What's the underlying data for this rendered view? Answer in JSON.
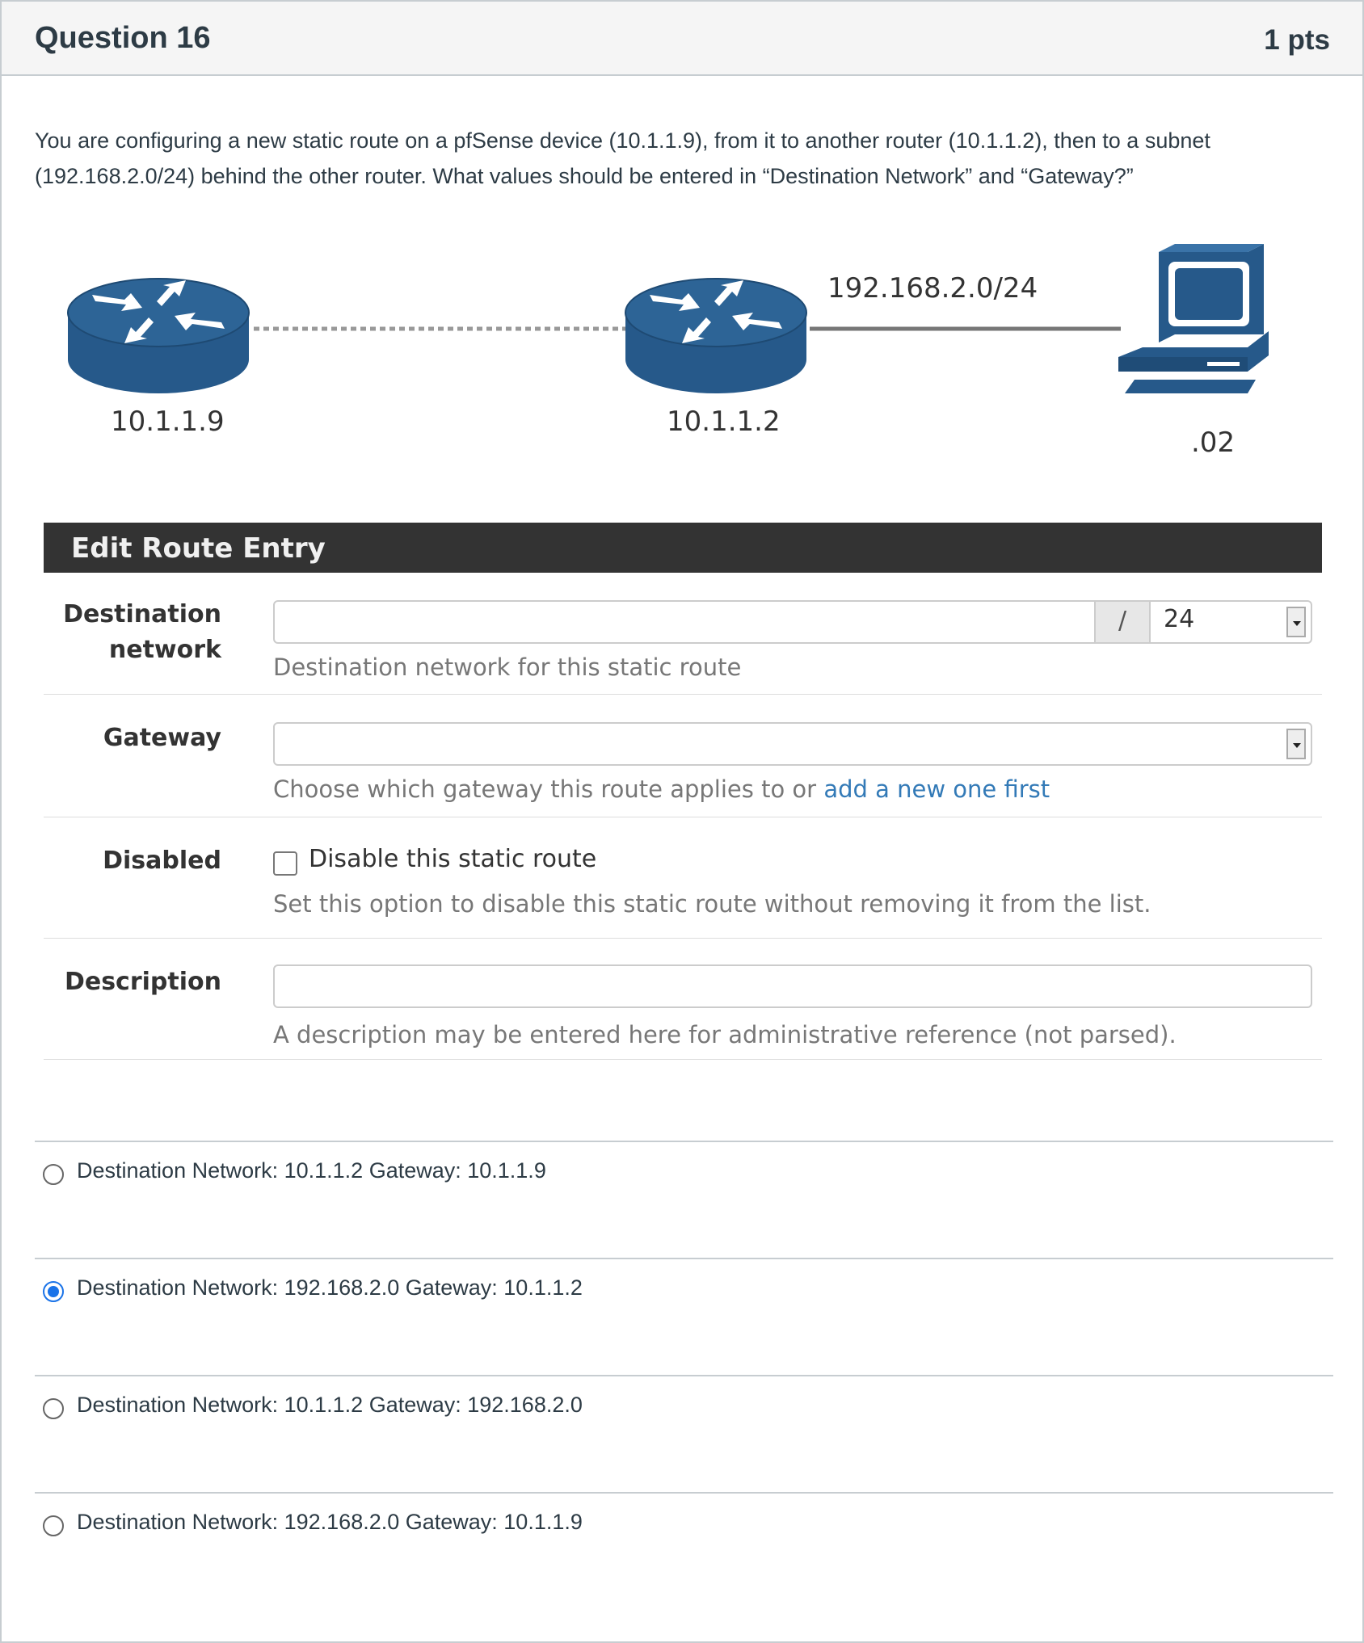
{
  "question": {
    "title": "Question 16",
    "points": "1 pts",
    "text": "You are configuring a new static route on a pfSense device (10.1.1.9), from it to another router (10.1.1.2), then to a subnet (192.168.2.0/24) behind the other router. What values should be entered in “Destination Network” and “Gateway?”"
  },
  "diagram": {
    "router1_label": "10.1.1.9",
    "router2_label": "10.1.1.2",
    "subnet_label": "192.168.2.0/24",
    "host_label": ".02",
    "device_color": "#26598a"
  },
  "route_panel": {
    "title": "Edit Route Entry",
    "destination": {
      "label_line1": "Destination",
      "label_line2": "network",
      "value": "",
      "slash": "/",
      "mask": "24",
      "help": "Destination network for this static route"
    },
    "gateway": {
      "label": "Gateway",
      "value": "",
      "help_prefix": "Choose which gateway this route applies to or ",
      "help_link": "add a new one first"
    },
    "disabled": {
      "label": "Disabled",
      "checkbox_label": "Disable this static route",
      "checked": false,
      "help": "Set this option to disable this static route without removing it from the list."
    },
    "description": {
      "label": "Description",
      "value": "",
      "help": "A description may be entered here for administrative reference (not parsed)."
    }
  },
  "answers": [
    {
      "text": "Destination Network: 10.1.1.2 Gateway: 10.1.1.9",
      "selected": false
    },
    {
      "text": "Destination Network: 192.168.2.0 Gateway: 10.1.1.2",
      "selected": true
    },
    {
      "text": "Destination Network: 10.1.1.2 Gateway: 192.168.2.0",
      "selected": false
    },
    {
      "text": "Destination Network: 192.168.2.0 Gateway: 10.1.1.9",
      "selected": false
    }
  ]
}
